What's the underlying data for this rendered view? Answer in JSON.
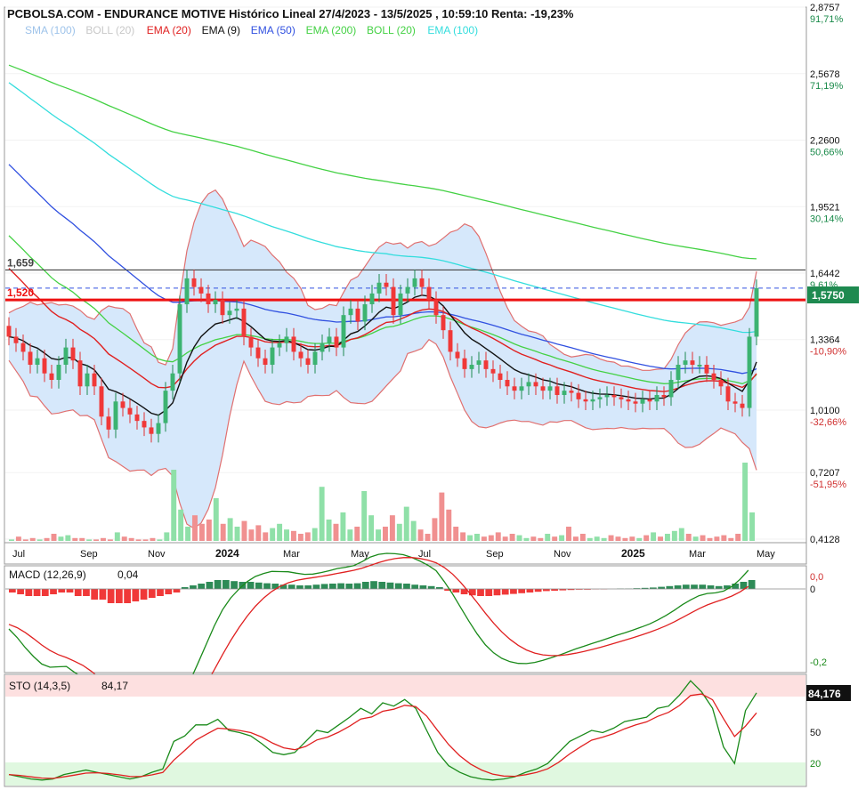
{
  "title": "PCBOLSA.COM - ENDURANCE MOTIVE Histórico Lineal 27/4/2023 - 13/5/2025 , 10:59:10 Renta: -19,23%",
  "legend": [
    {
      "label": "SMA (100)",
      "color": "#9ec3ea"
    },
    {
      "label": "BOLL (20)",
      "color": "#c8c8c8"
    },
    {
      "label": "EMA (20)",
      "color": "#e02020"
    },
    {
      "label": "EMA (9)",
      "color": "#111111"
    },
    {
      "label": "EMA (50)",
      "color": "#3050e0"
    },
    {
      "label": "EMA (200)",
      "color": "#44d144"
    },
    {
      "label": "BOLL (20)",
      "color": "#44d144"
    },
    {
      "label": "EMA (100)",
      "color": "#33dddd"
    }
  ],
  "price_axis": {
    "ticks": [
      {
        "value": 2.8757,
        "label": "2,8757",
        "pct": "91,71%"
      },
      {
        "value": 2.5678,
        "label": "2,5678",
        "pct": "71,19%"
      },
      {
        "value": 2.26,
        "label": "2,2600",
        "pct": "50,66%"
      },
      {
        "value": 1.9521,
        "label": "1,9521",
        "pct": "30,14%"
      },
      {
        "value": 1.6442,
        "label": "1,6442",
        "pct": "9,61%"
      },
      {
        "value": 1.3364,
        "label": "1,3364",
        "pct": "-10,90%"
      },
      {
        "value": 1.01,
        "label": "1,0100",
        "pct": "-32,66%"
      },
      {
        "value": 0.7207,
        "label": "0,7207",
        "pct": "-51,95%"
      },
      {
        "value": 0.4128,
        "label": "0,4128",
        "pct": ""
      }
    ],
    "last_price": "1,5750",
    "last_price_color": "#1e8a50"
  },
  "levels": [
    {
      "value": 1.659,
      "label": "1,659",
      "color": "#444444"
    },
    {
      "value": 1.52,
      "label": "1,520",
      "color": "#ee1111"
    }
  ],
  "x_axis": {
    "labels": [
      "Jul",
      "Sep",
      "Nov",
      "2024",
      "Mar",
      "May",
      "Jul",
      "Sep",
      "Nov",
      "2025",
      "Mar",
      "May"
    ],
    "bold": [
      "2024",
      "2025"
    ]
  },
  "macd": {
    "label": "MACD (12,26,9)",
    "value": "0,04",
    "ticks": [
      "0,0",
      "0",
      "-0,2"
    ]
  },
  "sto": {
    "label": "STO (14,3,5)",
    "value": "84,17",
    "last": "84,176",
    "ticks": [
      "50",
      "20"
    ]
  },
  "chart_data": {
    "type": "candlestick",
    "y_range": [
      0.4128,
      2.8757
    ],
    "closes": [
      1.35,
      1.32,
      1.28,
      1.22,
      1.25,
      1.18,
      1.15,
      1.22,
      1.3,
      1.24,
      1.12,
      1.18,
      1.12,
      0.98,
      0.92,
      1.05,
      1.02,
      0.99,
      0.96,
      0.93,
      0.9,
      0.95,
      1.1,
      1.18,
      1.5,
      1.62,
      1.58,
      1.55,
      1.5,
      1.52,
      1.45,
      1.47,
      1.48,
      1.35,
      1.3,
      1.25,
      1.22,
      1.3,
      1.32,
      1.35,
      1.28,
      1.25,
      1.22,
      1.28,
      1.32,
      1.35,
      1.3,
      1.45,
      1.48,
      1.42,
      1.5,
      1.55,
      1.6,
      1.58,
      1.45,
      1.55,
      1.58,
      1.62,
      1.58,
      1.52,
      1.45,
      1.38,
      1.28,
      1.25,
      1.2,
      1.22,
      1.24,
      1.2,
      1.18,
      1.15,
      1.12,
      1.1,
      1.12,
      1.14,
      1.12,
      1.1,
      1.12,
      1.08,
      1.1,
      1.09,
      1.06,
      1.05,
      1.06,
      1.07,
      1.08,
      1.07,
      1.06,
      1.05,
      1.04,
      1.06,
      1.05,
      1.08,
      1.07,
      1.15,
      1.22,
      1.24,
      1.22,
      1.22,
      1.18,
      1.15,
      1.12,
      1.05,
      1.04,
      1.02,
      1.35,
      1.575
    ],
    "volumes": [
      0.01,
      0.03,
      0.01,
      0.02,
      0.01,
      0.02,
      0.05,
      0.03,
      0.04,
      0.02,
      0.02,
      0.01,
      0.01,
      0.02,
      0.01,
      0.06,
      0.03,
      0.02,
      0.01,
      0.01,
      0.02,
      0.01,
      0.06,
      0.5,
      0.22,
      0.1,
      0.18,
      0.12,
      0.15,
      0.3,
      0.12,
      0.16,
      0.1,
      0.14,
      0.08,
      0.11,
      0.06,
      0.09,
      0.12,
      0.08,
      0.07,
      0.05,
      0.06,
      0.09,
      0.38,
      0.15,
      0.12,
      0.2,
      0.08,
      0.1,
      0.35,
      0.18,
      0.08,
      0.1,
      0.18,
      0.12,
      0.24,
      0.14,
      0.08,
      0.05,
      0.16,
      0.34,
      0.22,
      0.1,
      0.06,
      0.04,
      0.05,
      0.03,
      0.04,
      0.06,
      0.03,
      0.05,
      0.04,
      0.02,
      0.03,
      0.02,
      0.05,
      0.03,
      0.04,
      0.1,
      0.03,
      0.05,
      0.02,
      0.03,
      0.02,
      0.04,
      0.03,
      0.02,
      0.03,
      0.02,
      0.04,
      0.06,
      0.03,
      0.05,
      0.07,
      0.09,
      0.05,
      0.03,
      0.04,
      0.02,
      0.03,
      0.04,
      0.02,
      0.05,
      0.55,
      0.2
    ],
    "macd_hist": [
      -0.01,
      -0.015,
      -0.02,
      -0.02,
      -0.02,
      -0.015,
      -0.01,
      -0.01,
      -0.02,
      -0.02,
      -0.03,
      -0.03,
      -0.04,
      -0.04,
      -0.04,
      -0.035,
      -0.03,
      -0.025,
      -0.02,
      -0.015,
      -0.01,
      0.005,
      0.01,
      0.015,
      0.02,
      0.025,
      0.025,
      0.022,
      0.02,
      0.02,
      0.018,
      0.016,
      0.015,
      0.012,
      0.012,
      0.01,
      0.01,
      0.012,
      0.014,
      0.015,
      0.016,
      0.015,
      0.016,
      0.02,
      0.022,
      0.02,
      0.018,
      0.016,
      0.015,
      0.012,
      0.01,
      0.008,
      0.005,
      -0.005,
      -0.01,
      -0.015,
      -0.018,
      -0.02,
      -0.02,
      -0.018,
      -0.016,
      -0.014,
      -0.012,
      -0.01,
      -0.008,
      -0.006,
      -0.005,
      -0.004,
      -0.003,
      -0.002,
      -0.002,
      -0.001,
      -0.001,
      0.0,
      0.001,
      0.001,
      0.002,
      0.003,
      0.004,
      0.006,
      0.008,
      0.01,
      0.012,
      0.012,
      0.012,
      0.01,
      0.008,
      0.01,
      0.015,
      0.02,
      0.025
    ],
    "sto_k": [
      10,
      8,
      6,
      5,
      6,
      10,
      12,
      14,
      12,
      10,
      8,
      6,
      8,
      12,
      15,
      40,
      45,
      55,
      55,
      60,
      50,
      48,
      45,
      38,
      30,
      28,
      30,
      40,
      50,
      48,
      55,
      62,
      70,
      65,
      75,
      72,
      78,
      70,
      50,
      30,
      18,
      12,
      8,
      6,
      5,
      6,
      8,
      12,
      15,
      20,
      30,
      40,
      45,
      50,
      48,
      52,
      58,
      60,
      62,
      70,
      72,
      82,
      95,
      85,
      70,
      35,
      20,
      68,
      84
    ]
  }
}
